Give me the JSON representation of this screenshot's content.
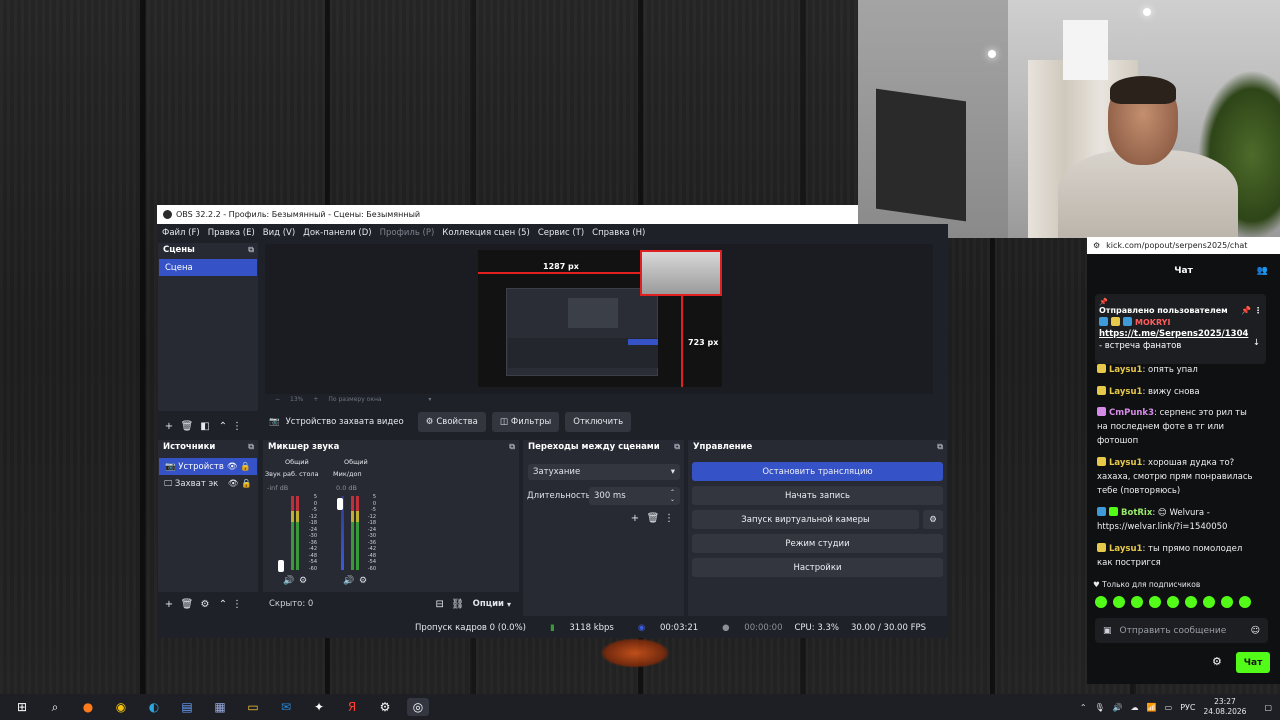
{
  "obs": {
    "window_title": "OBS 32.2.2 - Профиль: Безымянный - Сцены: Безымянный",
    "menu": [
      "Файл (F)",
      "Правка (E)",
      "Вид (V)",
      "Док-панели (D)",
      "Профиль (P)",
      "Коллекция сцен (5)",
      "Сервис (T)",
      "Справка (H)"
    ],
    "scenes": {
      "title": "Сцены",
      "items": [
        "Сцена"
      ]
    },
    "preview": {
      "width_label": "1287 px",
      "height_label": "723 px",
      "zoom": "13%",
      "fit_label": "По размеру окна"
    },
    "source_toolbar": {
      "source_name": "Устройство захвата видео",
      "props": "Свойства",
      "filters": "Фильтры",
      "disable": "Отключить"
    },
    "sources": {
      "title": "Источники",
      "items": [
        {
          "name": "Устройств"
        },
        {
          "name": "Захват эк"
        }
      ]
    },
    "mixer": {
      "title": "Микшер звука",
      "channels": [
        {
          "tag": "Общий",
          "name": "Звук раб. стола",
          "db": "-inf dB",
          "level": 0.0
        },
        {
          "tag": "Общий",
          "name": "Мик/доп",
          "db": "0.0 dB",
          "level": 1.0
        }
      ],
      "scale": [
        "5",
        "0",
        "-5",
        "-12",
        "-18",
        "-24",
        "-30",
        "-36",
        "-42",
        "-48",
        "-54",
        "-60"
      ],
      "hidden": "Скрыто: 0",
      "options": "Опции"
    },
    "transitions": {
      "title": "Переходы между сценами",
      "type": "Затухание",
      "duration_label": "Длительность",
      "duration": "300 ms"
    },
    "controls": {
      "title": "Управление",
      "buttons": [
        "Остановить трансляцию",
        "Начать запись",
        "Запуск виртуальной камеры",
        "Режим студии",
        "Настройки"
      ]
    },
    "status": {
      "dropped": "Пропуск кадров 0 (0.0%)",
      "bitrate": "3118 kbps",
      "stream_time": "00:03:21",
      "rec_time": "00:00:00",
      "cpu": "CPU: 3.3%",
      "fps": "30.00 / 30.00 FPS"
    }
  },
  "chat": {
    "url": "kick.com/popout/serpens2025/chat",
    "title": "Чат",
    "pinned": {
      "label": "Отправлено пользователем",
      "user": "MOKRYI",
      "link": "https://t.me/Serpens2025/1304",
      "text": " - встреча фанатов"
    },
    "messages": [
      {
        "user": "Laysu1",
        "color": "#e6c84a",
        "text": ": опять упал"
      },
      {
        "user": "Laysu1",
        "color": "#e6c84a",
        "text": ": вижу снова"
      },
      {
        "user": "CmPunk3",
        "color": "#d78be8",
        "text": ": серпенс это рил ты на последнем фоте в тг или фотошоп"
      },
      {
        "user": "Laysu1",
        "color": "#e6c84a",
        "text": ": хорошая дудка то? хахаха, смотрю прям понравилась тебе (повторяюсь)"
      },
      {
        "user": "BotRix",
        "color": "#9aea6b",
        "text": ": 😊 Welvura - https://welvar.link/?i=1540050"
      },
      {
        "user": "Laysu1",
        "color": "#e6c84a",
        "text": ": ты прямо помолодел как постригся"
      }
    ],
    "subs_only": "Только для подписчиков",
    "input_placeholder": "Отправить сообщение",
    "send": "Чат"
  },
  "taskbar": {
    "time": "23:27",
    "date": "24.08.2026",
    "lang": "РУС"
  },
  "colors": {
    "obs_bg": "#1f2128",
    "accent": "#3552c7",
    "kick_green": "#53fc18"
  }
}
